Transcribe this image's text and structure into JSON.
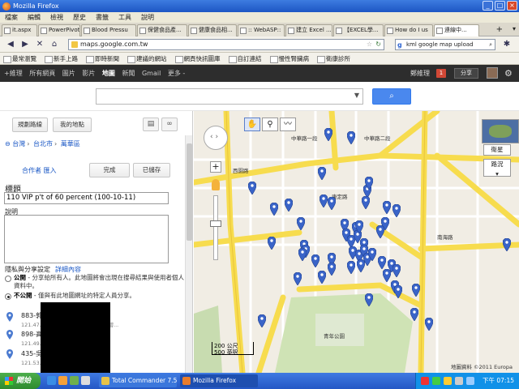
{
  "window": {
    "title": "Mozilla Firefox"
  },
  "menu": [
    "檔案",
    "編輯",
    "檢視",
    "歷史",
    "書籤",
    "工具",
    "說明"
  ],
  "tabs": [
    {
      "label": "it.aspx"
    },
    {
      "label": "PowerPivot"
    },
    {
      "label": "Blood Pressu"
    },
    {
      "label": "保健食品產..."
    },
    {
      "label": "健康食品相..."
    },
    {
      "label": ":: WebASP::"
    },
    {
      "label": "建立 Excel ..."
    },
    {
      "label": "【EXCEL學..."
    },
    {
      "label": "How do I us"
    },
    {
      "label": "連線中..."
    }
  ],
  "navbar": {
    "url": "maps.google.com.tw",
    "search_text": "kml google map upload"
  },
  "bookmarks": [
    "最常瀏覽",
    "新手上路",
    "即時新聞",
    "建議的網站",
    "網頁快訊圖庫",
    "自訂連結",
    "慢性腎臟病",
    "衛康診所"
  ],
  "gbar": {
    "items": [
      "+維理",
      "所有網頁",
      "圖片",
      "影片",
      "地圖",
      "新聞",
      "Gmail",
      "更多 -"
    ],
    "active_index": 4,
    "user": "鄭維理",
    "notif_count": "1",
    "share": "分享"
  },
  "left": {
    "btn_directions": "規劃路線",
    "btn_mymaps": "我的地點",
    "print_icon": "▤",
    "link_icon": "∞",
    "breadcrumb": [
      "台灣",
      "台北市",
      "萬華區"
    ],
    "collab": "合作者  匯入",
    "btn_done": "完成",
    "btn_saved": "已儲存",
    "title_label": "標題",
    "title_value": "110 VIP p't of 60 percent (100-10-11)",
    "desc_label": "說明",
    "privacy_label": "隱私與分享設定",
    "privacy_link": "詳細內容",
    "public_bold": "公開",
    "public_text": " - 分享給所有人。此地圖將會出現在搜尋結果與使用者個人資料中。",
    "private_bold": "不公開",
    "private_text": " - 僅與有此地圖網址的特定人員分享。",
    "places": [
      {
        "name": "883-郭",
        "addr": "121.47... 二路220巷9號之1 883-郭碧..."
      },
      {
        "name": "898-高",
        "addr": "121.49... 198號 898-高... 美華 2"
      },
      {
        "name": "435-吳",
        "addr": "121.53... 7號 435-吳..."
      }
    ]
  },
  "map": {
    "btn_satellite": "衛星",
    "btn_traffic": "路況",
    "scale_metric": "200 公尺",
    "scale_imperial": "500 英呎",
    "copyright": "地圖資料 ©2011 Europa",
    "labels": {
      "road_zhonghua1": "中華路一段",
      "road_zhonghua2": "中華路二段",
      "road_xiyuan": "西園路",
      "road_kangding": "康定路",
      "park": "青年公園",
      "green": "南海路"
    }
  },
  "taskbar": {
    "start": "開始",
    "items": [
      "Total Commander 7.5...",
      "Mozilla Firefox"
    ],
    "clock": "下午 07:15"
  }
}
